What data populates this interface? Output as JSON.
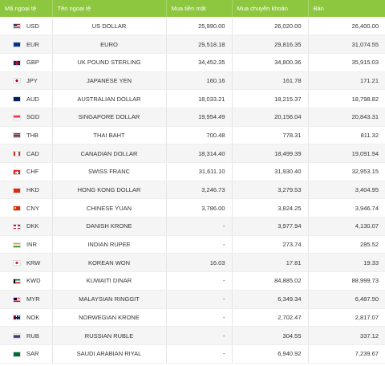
{
  "headers": {
    "code": "Mã ngoại tệ",
    "name": "Tên ngoại tệ",
    "cash_buy": "Mua tiền mặt",
    "transfer_buy": "Mua chuyển khoản",
    "sell": "Bán"
  },
  "colors": {
    "header_bg": "#8dc63f",
    "header_text": "#ffffff",
    "row_alt": "#f5f5f5"
  },
  "rows": [
    {
      "flag": "us-flag-icon",
      "code": "USD",
      "name": "US DOLLAR",
      "cash": "25,990.00",
      "transfer": "26,020.00",
      "sell": "26,400.00"
    },
    {
      "flag": "eu-flag-icon",
      "code": "EUR",
      "name": "EURO",
      "cash": "29,518.18",
      "transfer": "29,816.35",
      "sell": "31,074.55"
    },
    {
      "flag": "uk-flag-icon",
      "code": "GBP",
      "name": "UK POUND STERLING",
      "cash": "34,452.35",
      "transfer": "34,800.36",
      "sell": "35,915.03"
    },
    {
      "flag": "japan-flag-icon",
      "code": "JPY",
      "name": "JAPANESE YEN",
      "cash": "160.16",
      "transfer": "161.78",
      "sell": "171.21"
    },
    {
      "flag": "australia-flag-icon",
      "code": "AUD",
      "name": "AUSTRALIAN DOLLAR",
      "cash": "18,033.21",
      "transfer": "18,215.37",
      "sell": "18,798.82"
    },
    {
      "flag": "singapore-flag-icon",
      "code": "SGD",
      "name": "SINGAPORE DOLLAR",
      "cash": "19,954.49",
      "transfer": "20,156.04",
      "sell": "20,843.31"
    },
    {
      "flag": "thailand-flag-icon",
      "code": "THB",
      "name": "THAI BAHT",
      "cash": "700.48",
      "transfer": "778.31",
      "sell": "811.32"
    },
    {
      "flag": "canada-flag-icon",
      "code": "CAD",
      "name": "CANADIAN DOLLAR",
      "cash": "18,314.40",
      "transfer": "18,499.39",
      "sell": "19,091.94"
    },
    {
      "flag": "switzerland-flag-icon",
      "code": "CHF",
      "name": "SWISS FRANC",
      "cash": "31,611.10",
      "transfer": "31,930.40",
      "sell": "32,953.15"
    },
    {
      "flag": "hongkong-flag-icon",
      "code": "HKD",
      "name": "HONG KONG DOLLAR",
      "cash": "3,246.73",
      "transfer": "3,279.53",
      "sell": "3,404.95"
    },
    {
      "flag": "china-flag-icon",
      "code": "CNY",
      "name": "CHINESE YUAN",
      "cash": "3,786.00",
      "transfer": "3,824.25",
      "sell": "3,946.74"
    },
    {
      "flag": "denmark-flag-icon",
      "code": "DKK",
      "name": "DANISH KRONE",
      "cash": "-",
      "transfer": "3,977.94",
      "sell": "4,130.07"
    },
    {
      "flag": "india-flag-icon",
      "code": "INR",
      "name": "INDIAN RUPEE",
      "cash": "-",
      "transfer": "273.74",
      "sell": "285.52"
    },
    {
      "flag": "korea-flag-icon",
      "code": "KRW",
      "name": "KOREAN WON",
      "cash": "16.03",
      "transfer": "17.81",
      "sell": "19.33"
    },
    {
      "flag": "kuwait-flag-icon",
      "code": "KWD",
      "name": "KUWAITI DINAR",
      "cash": "-",
      "transfer": "84,885.02",
      "sell": "88,999.73"
    },
    {
      "flag": "malaysia-flag-icon",
      "code": "MYR",
      "name": "MALAYSIAN RINGGIT",
      "cash": "-",
      "transfer": "6,349.34",
      "sell": "6,487.50"
    },
    {
      "flag": "norway-flag-icon",
      "code": "NOK",
      "name": "NORWEGIAN KRONE",
      "cash": "-",
      "transfer": "2,702.47",
      "sell": "2,817.07"
    },
    {
      "flag": "russia-flag-icon",
      "code": "RUB",
      "name": "RUSSIAN RUBLE",
      "cash": "-",
      "transfer": "304.55",
      "sell": "337.12"
    },
    {
      "flag": "saudi-flag-icon",
      "code": "SAR",
      "name": "SAUDI ARABIAN RIYAL",
      "cash": "-",
      "transfer": "6,940.92",
      "sell": "7,239.67"
    }
  ]
}
